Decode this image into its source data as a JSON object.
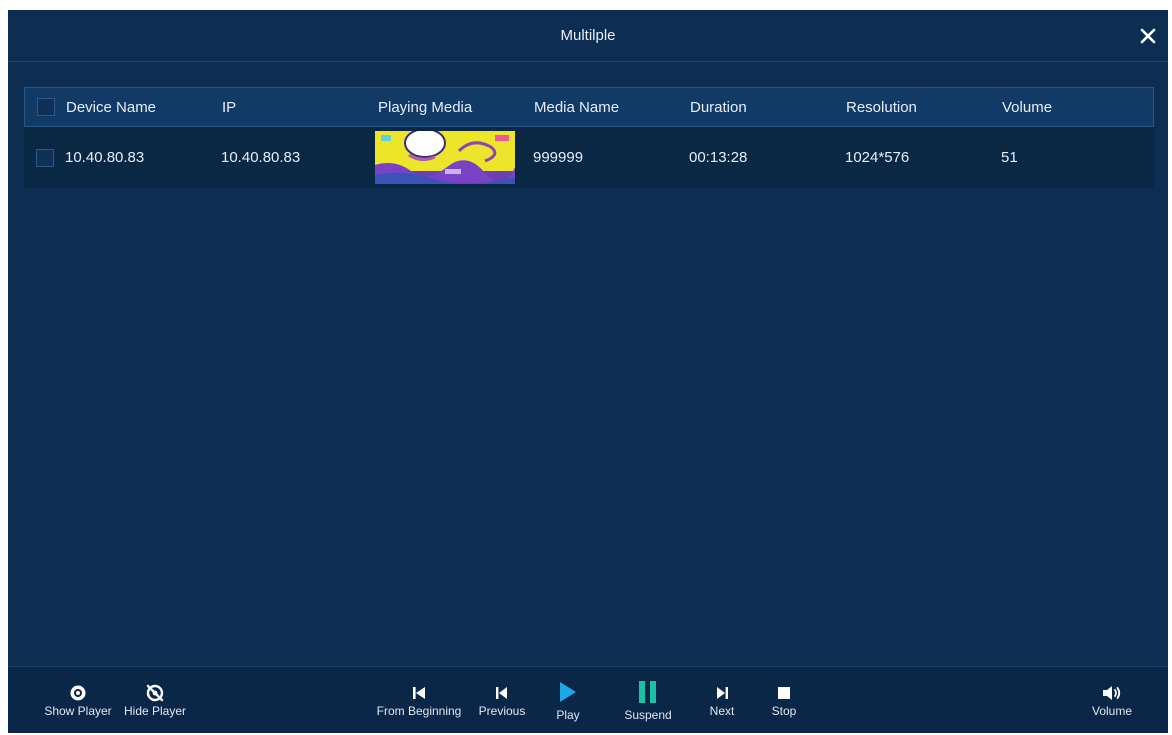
{
  "window": {
    "title": "Multilple"
  },
  "table": {
    "columns": [
      "Device Name",
      "IP",
      "Playing Media",
      "Media Name",
      "Duration",
      "Resolution",
      "Volume"
    ],
    "rows": [
      {
        "device_name": "10.40.80.83",
        "ip": "10.40.80.83",
        "playing_media": "media-thumbnail",
        "media_name": "999999",
        "duration": "00:13:28",
        "resolution": "1024*576",
        "volume": "51"
      }
    ]
  },
  "toolbar": {
    "show_player": "Show Player",
    "hide_player": "Hide Player",
    "from_beginning": "From Beginning",
    "previous": "Previous",
    "play": "Play",
    "suspend": "Suspend",
    "next": "Next",
    "stop": "Stop",
    "volume": "Volume"
  },
  "icons": {
    "close": "close-icon",
    "show_player": "eye-icon",
    "hide_player": "eye-off-icon",
    "from_beginning": "skip-to-start-icon",
    "previous": "previous-icon",
    "play": "play-icon",
    "suspend": "pause-icon",
    "next": "next-icon",
    "stop": "stop-icon",
    "volume": "speaker-icon"
  },
  "colors": {
    "background": "#0e2d52",
    "header_row": "#113a66",
    "data_row": "#0a2744",
    "play_accent": "#1ea7e8",
    "suspend_accent": "#19c3a6"
  }
}
